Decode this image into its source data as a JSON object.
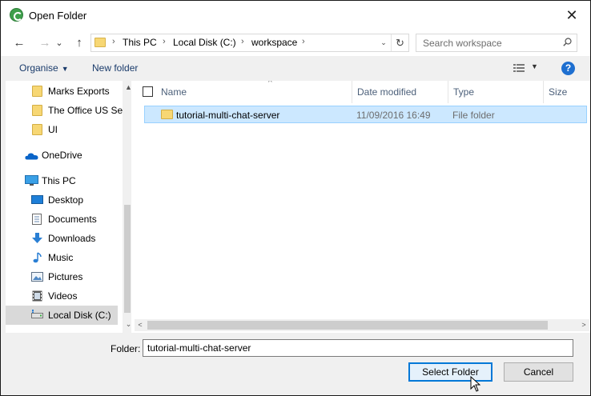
{
  "window": {
    "title": "Open Folder",
    "close_glyph": "✕"
  },
  "nav": {
    "back_glyph": "←",
    "forward_glyph": "→",
    "recent_glyph": "⌄",
    "up_glyph": "↑",
    "breadcrumbs": [
      "This PC",
      "Local Disk (C:)",
      "workspace"
    ],
    "separator": "›",
    "refresh_glyph": "↻",
    "dropdown_glyph": "⌄",
    "search_placeholder": "Search workspace"
  },
  "toolbar": {
    "organise_label": "Organise",
    "organise_caret": "▼",
    "new_folder_label": "New folder",
    "view_caret": "▼",
    "help_label": "?"
  },
  "sidebar": {
    "items": [
      {
        "label": "Marks Exports",
        "icon": "folder-icon"
      },
      {
        "label": "The Office US Se",
        "icon": "folder-icon"
      },
      {
        "label": "UI",
        "icon": "folder-icon"
      },
      {
        "label": "OneDrive",
        "icon": "onedrive-icon"
      },
      {
        "label": "This PC",
        "icon": "computer-icon"
      },
      {
        "label": "Desktop",
        "icon": "desktop-icon"
      },
      {
        "label": "Documents",
        "icon": "documents-icon"
      },
      {
        "label": "Downloads",
        "icon": "downloads-icon"
      },
      {
        "label": "Music",
        "icon": "music-icon"
      },
      {
        "label": "Pictures",
        "icon": "pictures-icon"
      },
      {
        "label": "Videos",
        "icon": "videos-icon"
      },
      {
        "label": "Local Disk (C:)",
        "icon": "drive-icon",
        "selected": true
      }
    ],
    "scroll_up": "▲",
    "scroll_down": "⌄"
  },
  "filelist": {
    "columns": [
      "Name",
      "Date modified",
      "Type",
      "Size"
    ],
    "sort_glyph": "^",
    "rows": [
      {
        "name": "tutorial-multi-chat-server",
        "date": "11/09/2016 16:49",
        "type": "File folder",
        "size": ""
      }
    ],
    "hscroll_left": "<",
    "hscroll_right": ">"
  },
  "footer": {
    "folder_label": "Folder:",
    "folder_value": "tutorial-multi-chat-server",
    "select_label": "Select Folder",
    "cancel_label": "Cancel"
  },
  "colors": {
    "accent": "#0078d7",
    "selection": "#cce8ff",
    "folder": "#f7d774"
  }
}
